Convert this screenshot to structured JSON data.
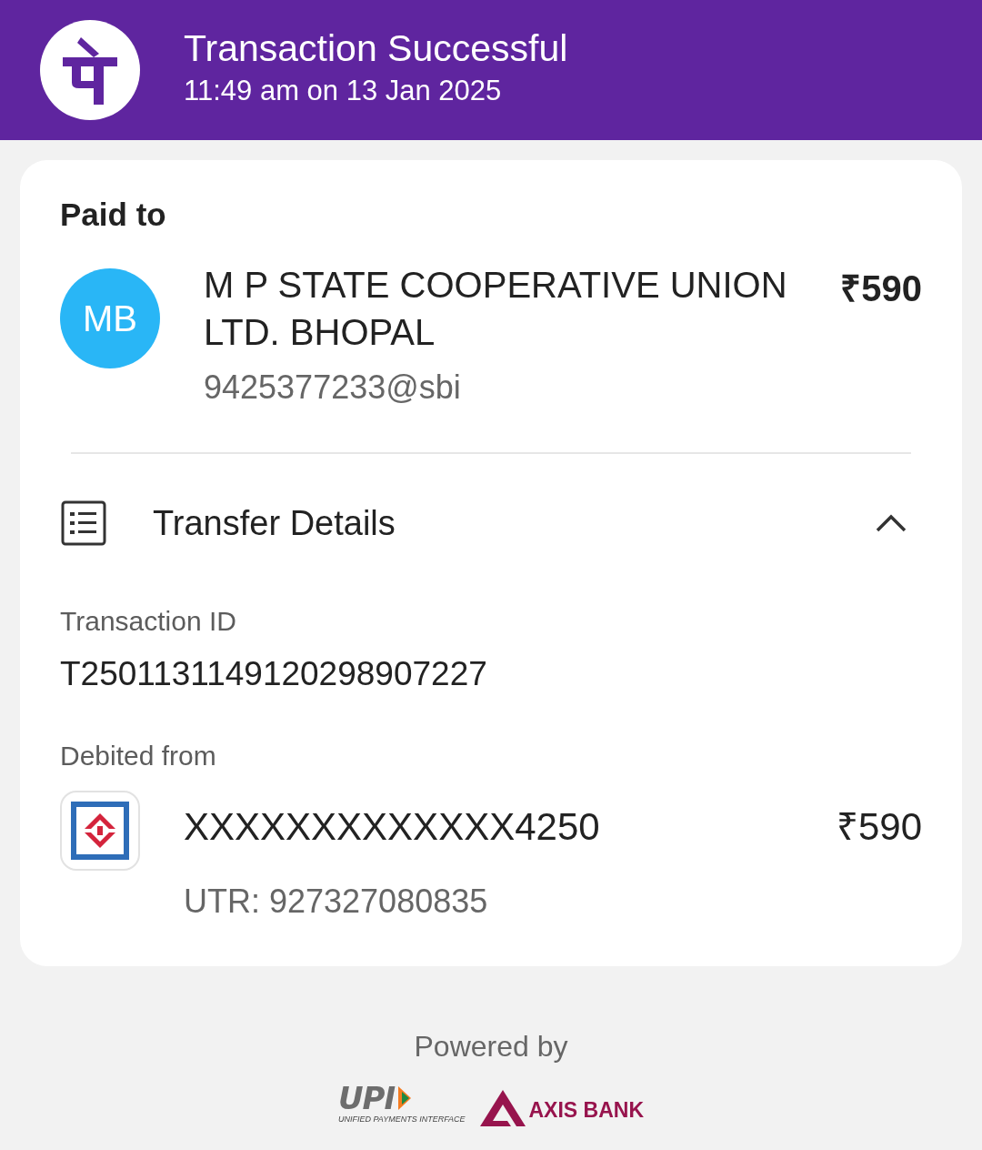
{
  "header": {
    "title": "Transaction Successful",
    "subtitle": "11:49 am on 13 Jan 2025"
  },
  "paid_to": {
    "label": "Paid to",
    "avatar": "MB",
    "name": "M P STATE COOPERATIVE UNION LTD. BHOPAL",
    "amount": "₹590",
    "vpa": "9425377233@sbi"
  },
  "transfer_details": {
    "title": "Transfer Details",
    "expanded": true,
    "fields": [
      {
        "label": "Transaction ID",
        "value": "T2501131149120298907227"
      }
    ],
    "debited_from": {
      "label": "Debited from",
      "account": "XXXXXXXXXXXXX4250",
      "amount": "₹590",
      "utr": "UTR: 927327080835"
    }
  },
  "footer": {
    "powered_by": "Powered by",
    "upi_logo": "UPI",
    "upi_tagline": "UNIFIED PAYMENTS INTERFACE",
    "bank_logo": "AXIS BANK"
  }
}
